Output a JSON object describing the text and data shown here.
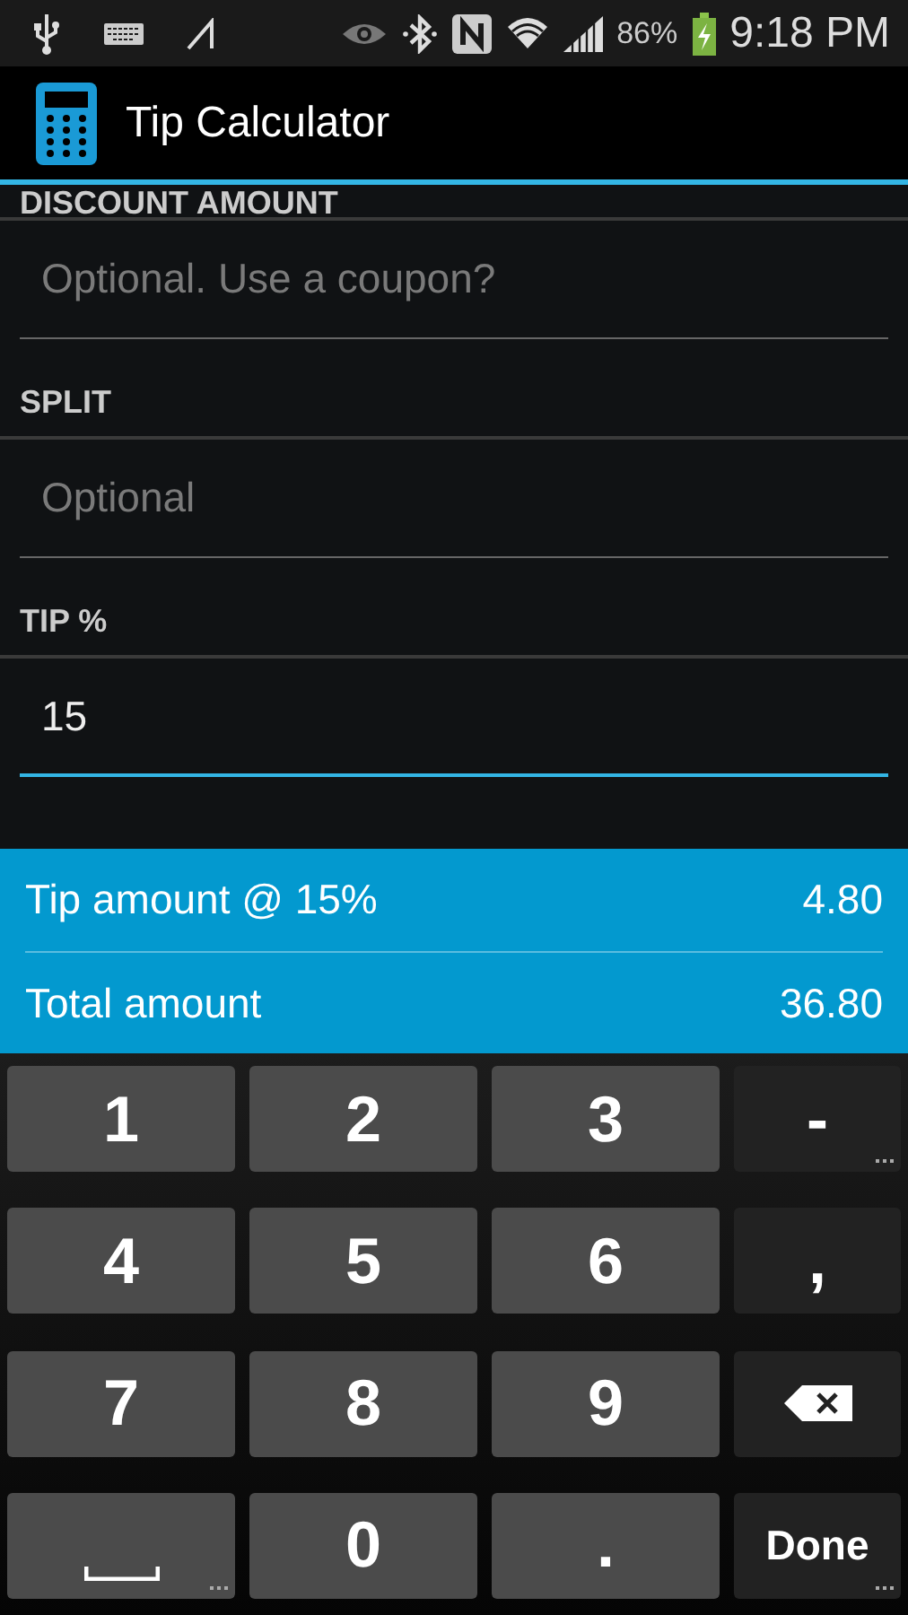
{
  "status_bar": {
    "battery_percent": "86%",
    "time": "9:18 PM"
  },
  "action_bar": {
    "title": "Tip Calculator"
  },
  "fields": [
    {
      "label": "DISCOUNT AMOUNT",
      "placeholder": "Optional. Use a coupon?",
      "focused": false
    },
    {
      "label": "SPLIT",
      "placeholder": "Optional",
      "focused": false
    },
    {
      "label": "TIP %",
      "value": "15",
      "focused": true
    }
  ],
  "results": [
    {
      "label": "Tip amount @ 15%",
      "value": "4.80"
    },
    {
      "label": "Total amount",
      "value": "36.80"
    }
  ],
  "keyboard": [
    {
      "kind": "digit",
      "label": "1",
      "more": false
    },
    {
      "kind": "digit",
      "label": "2",
      "more": false
    },
    {
      "kind": "digit",
      "label": "3",
      "more": false
    },
    {
      "kind": "symbol",
      "label": "-",
      "more": true
    },
    {
      "kind": "digit",
      "label": "4",
      "more": false
    },
    {
      "kind": "digit",
      "label": "5",
      "more": false
    },
    {
      "kind": "digit",
      "label": "6",
      "more": false
    },
    {
      "kind": "symbol",
      "label": ",",
      "more": false
    },
    {
      "kind": "digit",
      "label": "7",
      "more": false
    },
    {
      "kind": "digit",
      "label": "8",
      "more": false
    },
    {
      "kind": "digit",
      "label": "9",
      "more": false
    },
    {
      "kind": "backspace",
      "more": false
    },
    {
      "kind": "space",
      "more": true
    },
    {
      "kind": "digit",
      "label": "0",
      "more": false
    },
    {
      "kind": "digit",
      "label": ".",
      "more": false
    },
    {
      "kind": "action",
      "label": "Done",
      "more": true
    }
  ]
}
